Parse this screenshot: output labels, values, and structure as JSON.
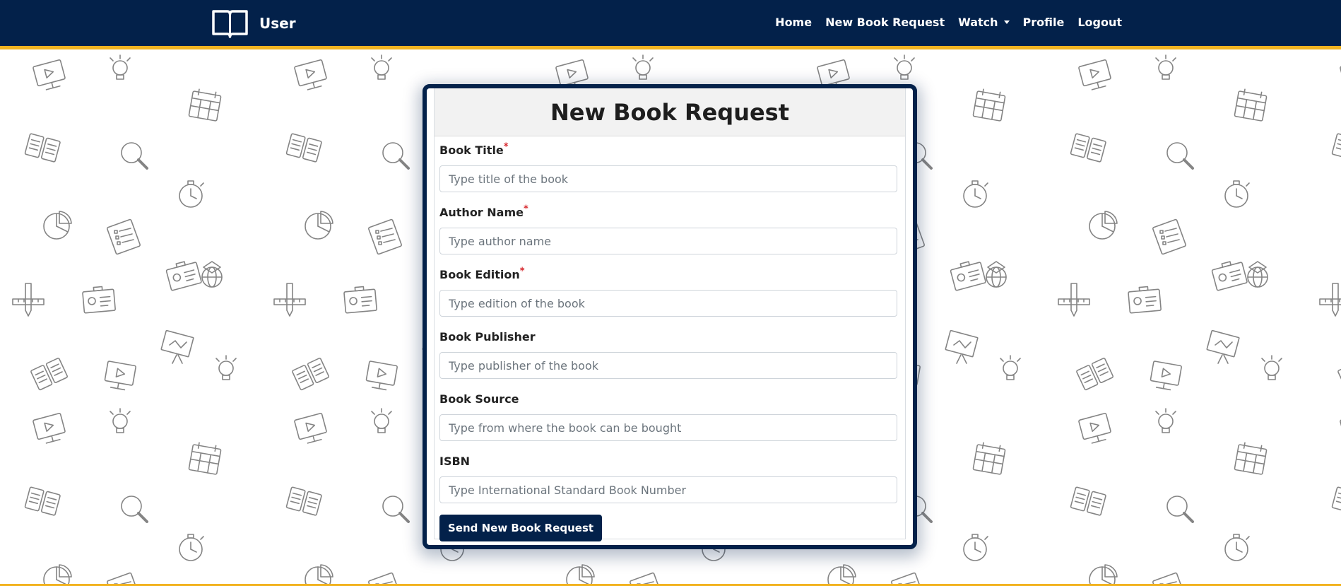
{
  "navbar": {
    "brand": "User",
    "links": {
      "home": "Home",
      "new_book_request": "New Book Request",
      "watch": "Watch",
      "profile": "Profile",
      "logout": "Logout"
    }
  },
  "colors": {
    "navy": "#03214a",
    "gold": "#f2b320",
    "required": "#d6262c"
  },
  "form": {
    "title": "New Book Request",
    "required_marker": "*",
    "fields": {
      "book_title": {
        "label": "Book Title",
        "placeholder": "Type title of the book",
        "value": ""
      },
      "author_name": {
        "label": "Author Name",
        "placeholder": "Type author name",
        "value": ""
      },
      "book_edition": {
        "label": "Book Edition",
        "placeholder": "Type edition of the book",
        "value": ""
      },
      "book_publisher": {
        "label": "Book Publisher",
        "placeholder": "Type publisher of the book",
        "value": ""
      },
      "book_source": {
        "label": "Book Source",
        "placeholder": "Type from where the book can be bought",
        "value": ""
      },
      "isbn": {
        "label": "ISBN",
        "placeholder": "Type International Standard Book Number",
        "value": ""
      }
    },
    "submit_label": "Send New Book Request"
  },
  "background_icons": [
    "book-icon",
    "lightbulb-icon",
    "magnifier-icon",
    "pie-chart-icon",
    "calendar-icon",
    "globe-icon",
    "monitor-icon",
    "id-card-icon",
    "stopwatch-icon",
    "pencil-ruler-icon",
    "checklist-icon",
    "presentation-icon"
  ]
}
